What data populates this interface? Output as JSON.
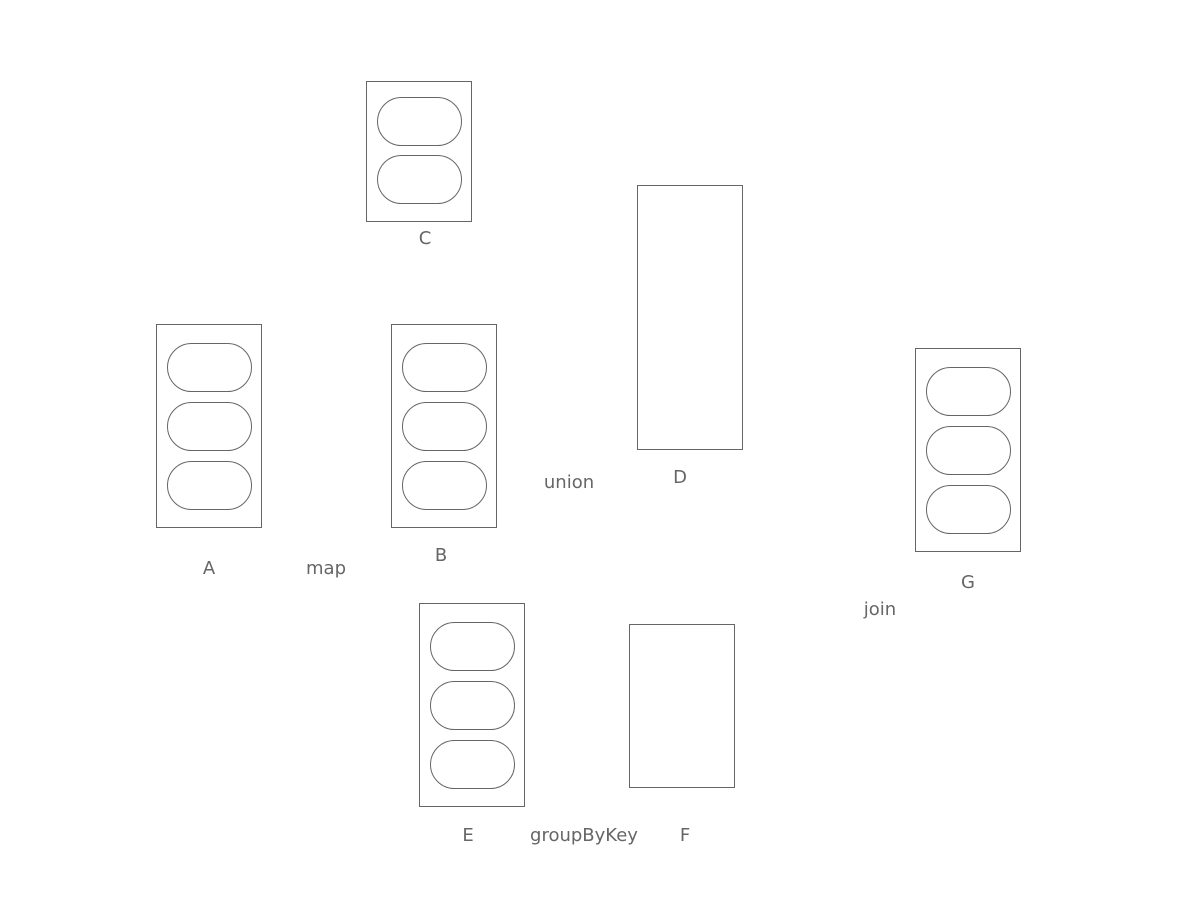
{
  "rdds": {
    "A": {
      "label": "A",
      "partitions": 3
    },
    "B": {
      "label": "B",
      "partitions": 3
    },
    "C": {
      "label": "C",
      "partitions": 2
    },
    "D": {
      "label": "D",
      "partitions": 0
    },
    "E": {
      "label": "E",
      "partitions": 3
    },
    "F": {
      "label": "F",
      "partitions": 0
    },
    "G": {
      "label": "G",
      "partitions": 3
    }
  },
  "operations": {
    "map": "map",
    "union": "union",
    "groupByKey": "groupByKey",
    "join": "join"
  },
  "colors": {
    "stroke": "#666666",
    "text": "#666666",
    "background": "#ffffff"
  }
}
